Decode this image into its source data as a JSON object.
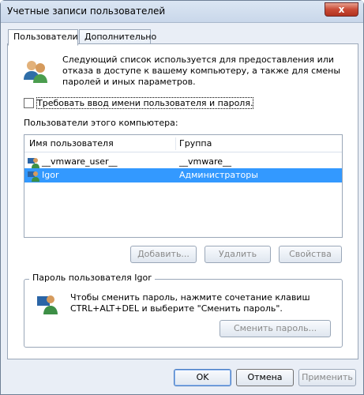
{
  "window": {
    "title": "Учетные записи пользователей",
    "close_label": "x"
  },
  "tabs": [
    {
      "label": "Пользователи"
    },
    {
      "label": "Дополнительно"
    }
  ],
  "description": "Следующий список используется для предоставления или отказа в доступе к вашему компьютеру, а также для смены паролей и иных параметров.",
  "require_login": {
    "label": "Требовать ввод имени пользователя и пароля.",
    "checked": false
  },
  "users_section": {
    "label": "Пользователи этого компьютера:"
  },
  "table": {
    "columns": [
      "Имя пользователя",
      "Группа"
    ],
    "rows": [
      {
        "name": "__vmware_user__",
        "group": "__vmware__"
      },
      {
        "name": "Igor",
        "group": "Администраторы"
      }
    ]
  },
  "buttons": {
    "add": "Добавить...",
    "delete": "Удалить",
    "properties": "Свойства",
    "change_password": "Сменить пароль...",
    "ok": "OK",
    "cancel": "Отмена",
    "apply": "Применить"
  },
  "password_group": {
    "title": "Пароль пользователя Igor",
    "text": "Чтобы сменить пароль, нажмите сочетание клавиш CTRL+ALT+DEL и выберите \"Сменить пароль\"."
  }
}
